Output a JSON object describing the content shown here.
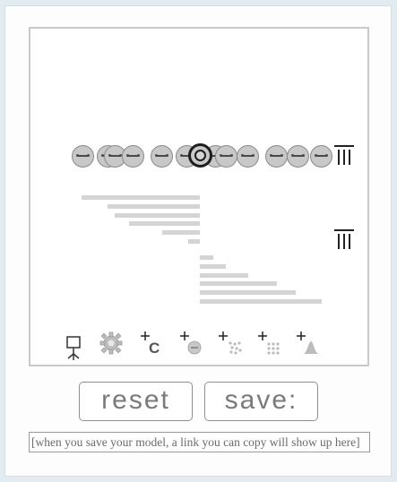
{
  "buttons": {
    "reset_label": "reset",
    "save_label": "save:"
  },
  "link_field": {
    "text": "[when you save your model, a link you can copy will show up here]"
  },
  "model": {
    "row_item_count": 12,
    "selected_item_index": 6,
    "histogram_top_values": [
      1.0,
      0.78,
      0.72,
      0.6,
      0.32,
      0.1
    ],
    "histogram_bottom_values": [
      0.11,
      0.21,
      0.4,
      0.63,
      0.79,
      1.0
    ]
  },
  "toolbar": {
    "tools": [
      {
        "name": "plant-icon"
      },
      {
        "name": "gear-icon"
      },
      {
        "name": "add-c-icon"
      },
      {
        "name": "add-face-icon"
      },
      {
        "name": "add-dots-scatter-icon"
      },
      {
        "name": "add-dots-grid-icon"
      },
      {
        "name": "add-distribution-icon"
      }
    ]
  },
  "icons": {
    "trash_top": "trash-icon",
    "trash_middle": "trash-icon"
  },
  "colors": {
    "canvas_border": "#c9c9c9",
    "face_fill": "#c8c8c8",
    "bar_fill": "#d4d4d4",
    "page_bg": "#e2ebef"
  }
}
